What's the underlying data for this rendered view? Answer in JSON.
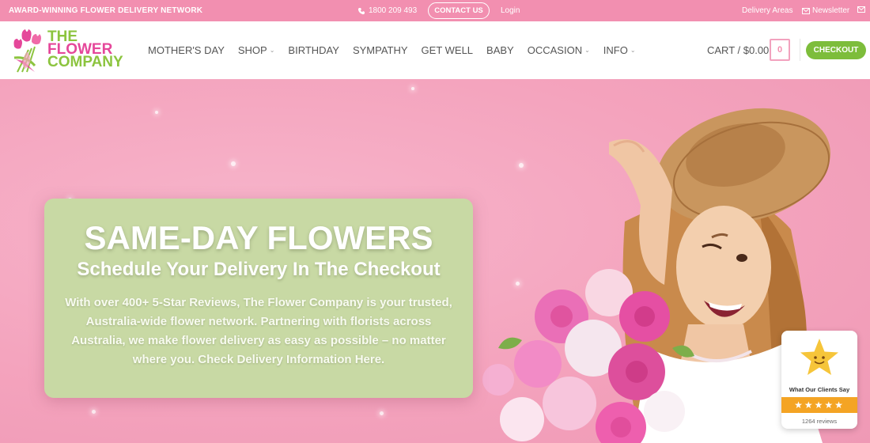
{
  "topbar": {
    "tagline": "AWARD-WINNING FLOWER DELIVERY NETWORK",
    "phone": "1800 209 493",
    "contact": "CONTACT US",
    "login": "Login",
    "delivery_areas": "Delivery Areas",
    "newsletter": "Newsletter"
  },
  "logo": {
    "line1": "THE",
    "line2": "FLOWER",
    "line3": "COMPANY"
  },
  "nav": {
    "items": [
      {
        "label": "MOTHER'S DAY"
      },
      {
        "label": "SHOP"
      },
      {
        "label": "BIRTHDAY"
      },
      {
        "label": "SYMPATHY"
      },
      {
        "label": "GET WELL"
      },
      {
        "label": "BABY"
      },
      {
        "label": "OCCASION"
      },
      {
        "label": "INFO"
      }
    ]
  },
  "cart": {
    "label": "CART / $0.00",
    "count": "0",
    "checkout": "CHECKOUT"
  },
  "hero": {
    "title": "SAME-DAY FLOWERS",
    "subtitle": "Schedule Your Delivery In The Checkout",
    "body": "With over 400+ 5-Star Reviews, The Flower Company is your trusted, Australia-wide flower network. Partnering with florists across Australia, we make flower delivery as easy as possible – no matter where you. Check Delivery Information Here."
  },
  "review_badge": {
    "heading": "What Our Clients Say",
    "stars": "★★★★★",
    "count": "1264 reviews"
  },
  "colors": {
    "topbar": "#f28fb0",
    "hero_bg": "#f4a3bd",
    "panel": "#c8d9a4",
    "checkout": "#7dbd3b",
    "brand_green": "#8cc43f",
    "brand_pink": "#e5479a"
  },
  "icons": [
    "phone-icon",
    "mail-icon",
    "chevron-down-icon",
    "star-icon"
  ]
}
